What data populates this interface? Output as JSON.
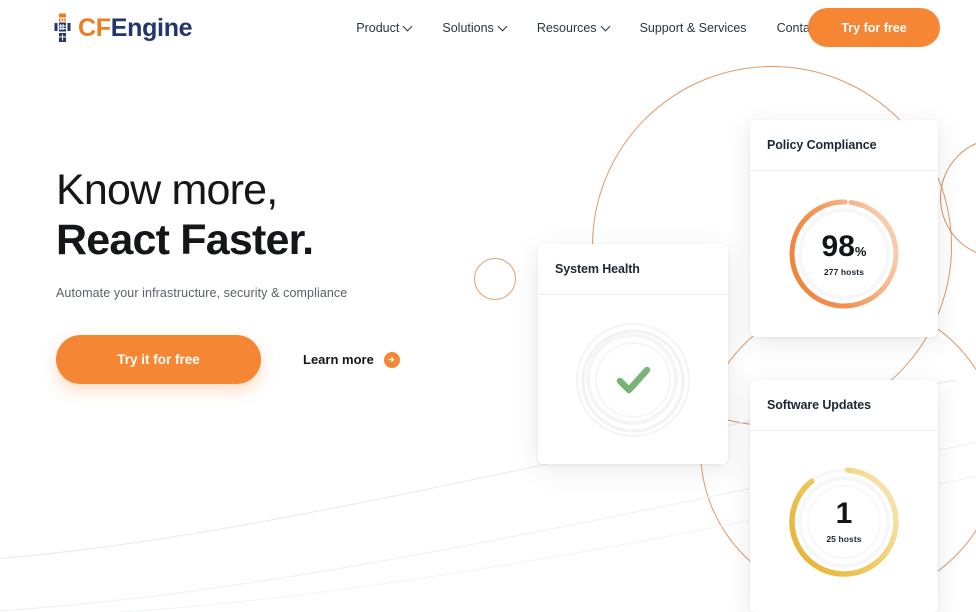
{
  "brand": {
    "prefix": "CF",
    "suffix": "Engine",
    "logo_icon": "cfengine-robot-icon",
    "accent_color": "#f07c22",
    "text_color": "#22356f"
  },
  "nav": {
    "items": [
      {
        "label": "Product",
        "has_dropdown": true,
        "icon": "chevron-down-icon"
      },
      {
        "label": "Solutions",
        "has_dropdown": true,
        "icon": "chevron-down-icon"
      },
      {
        "label": "Resources",
        "has_dropdown": true,
        "icon": "chevron-down-icon"
      },
      {
        "label": "Support & Services",
        "has_dropdown": false
      },
      {
        "label": "Contact Us",
        "has_dropdown": false
      }
    ],
    "cta_label": "Try for free"
  },
  "hero": {
    "headline_line1": "Know more,",
    "headline_line2": "React Faster.",
    "subheadline": "Automate your infrastructure, security & compliance",
    "primary_button": "Try it for free",
    "secondary_link": "Learn more",
    "secondary_link_icon": "arrow-right-circle-icon",
    "button_color": "#f58634"
  },
  "cards": {
    "policy_compliance": {
      "title": "Policy Compliance",
      "value": "98",
      "unit": "%",
      "subtext": "277 hosts",
      "ring_color_start": "#f0813a",
      "ring_color_end": "#f7c6a4",
      "percent": 98
    },
    "software_updates": {
      "title": "Software Updates",
      "value": "1",
      "unit": "",
      "subtext": "25 hosts",
      "ring_color_start": "#e8b53a",
      "ring_color_end": "#f6dfa0",
      "percent": 88
    },
    "system_health": {
      "title": "System Health",
      "status_icon": "check-mark-icon",
      "status_color": "#79b377"
    }
  },
  "decorations": {
    "circle_outline_color": "#e0a070",
    "arc_color": "#dd9a6a",
    "swoosh_color": "#ededf0"
  }
}
